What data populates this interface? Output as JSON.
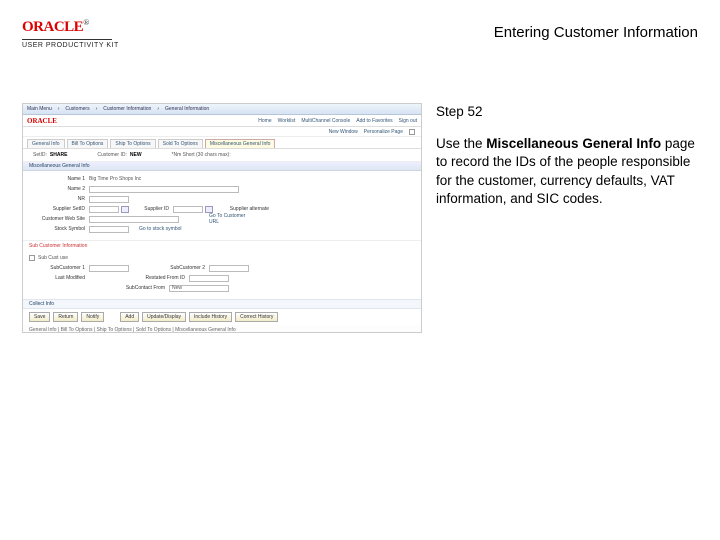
{
  "header": {
    "brand": "ORACLE",
    "tm": "®",
    "product": "USER PRODUCTIVITY KIT",
    "title": "Entering Customer Information"
  },
  "instruction": {
    "step_label": "Step 52",
    "body_prefix": "Use the ",
    "body_bold": "Miscellaneous General Info",
    "body_suffix": " page to record the IDs of the people responsible for the customer, currency defaults, VAT information, and SIC codes."
  },
  "screenshot": {
    "breadcrumb": [
      "Main Menu",
      "Customers",
      "Customer Information",
      "General Information"
    ],
    "oracle": "ORACLE",
    "nav": [
      "Home",
      "Worklist",
      "MultiChannel Console",
      "Add to Favorites",
      "Sign out"
    ],
    "user_row": {
      "new_window": "New Window",
      "personalize": "Personalize Page"
    },
    "tabs": [
      "General Info",
      "Bill To Options",
      "Ship To Options",
      "Sold To Options",
      "Miscellaneous General Info"
    ],
    "key": {
      "setid_label": "SetID:",
      "setid_value": "SHARE",
      "cust_label": "Customer ID:",
      "cust_value": "NEW",
      "short_label": "*Nm Short (30 chars max):"
    },
    "section1": "Miscellaneous General Info",
    "fields": {
      "name1": "Name 1",
      "name1_val": "Big Time Pro Shops Inc",
      "name2": "Name 2",
      "nr": "NR",
      "supplier_set": "Supplier SetID",
      "supplier_id": "Supplier ID",
      "supplier_alt": "Supplier alternate",
      "web": "Customer Web Site",
      "web_url": "Go To Customer URL",
      "stock": "Stock Symbol",
      "stock_url": "Go to stock symbol"
    },
    "section2": "Sub Customer Information",
    "sub": {
      "sub_use": "Sub Cust use",
      "sub1": "SubCustomer 1",
      "sub2": "SubCustomer 2",
      "last": "Last Modified",
      "restated": "Restated From ID",
      "subref": "SubContact From",
      "subref_val": "New"
    },
    "collect": "Collect Info",
    "buttons": [
      "Save",
      "Return",
      "Notify",
      "Add",
      "Update/Display",
      "Include History",
      "Correct History"
    ],
    "footer": "General Info | Bill To Options | Ship To Options | Sold To Options | Miscellaneous General Info"
  }
}
